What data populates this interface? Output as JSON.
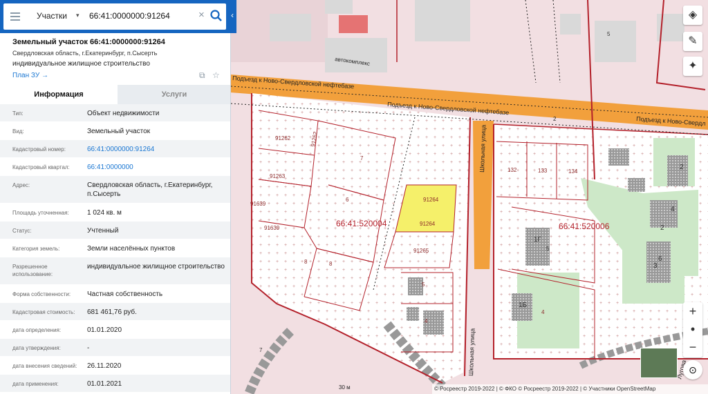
{
  "search": {
    "type_label": "Участки",
    "value": "66:41:0000000:91264"
  },
  "parcel": {
    "title": "Земельный участок 66:41:0000000:91264",
    "address": "Свердловская область, г.Екатеринбург, п.Сысерть",
    "use": "индивидуальное жилищное строительство",
    "plan_link": "План ЗУ →"
  },
  "tabs": [
    {
      "label": "Информация"
    },
    {
      "label": "Услуги"
    }
  ],
  "info_rows": [
    {
      "label": "Тип:",
      "value": "Объект недвижимости"
    },
    {
      "label": "Вид:",
      "value": "Земельный участок"
    },
    {
      "label": "Кадастровый номер:",
      "value": "66:41:0000000:91264"
    },
    {
      "label": "Кадастровый квартал:",
      "value": "66:41:0000000"
    },
    {
      "label": "Адрес:",
      "value": "Свердловская область, г.Екатеринбург, п.Сысерть"
    },
    {
      "label": "Площадь уточненная:",
      "value": "1 024 кв. м"
    },
    {
      "label": "Статус:",
      "value": "Учтенный"
    },
    {
      "label": "Категория земель:",
      "value": "Земли населённых пунктов"
    },
    {
      "label": "Разрешенное использование:",
      "value": "индивидуальное жилищное строительство"
    },
    {
      "label": "Форма собственности:",
      "value": "Частная собственность"
    },
    {
      "label": "Кадастровая стоимость:",
      "value": "681 461,76 руб."
    },
    {
      "label": "дата определения:",
      "value": "01.01.2020"
    },
    {
      "label": "дата утверждения:",
      "value": "-"
    },
    {
      "label": "дата внесения сведений:",
      "value": "26.11.2020"
    },
    {
      "label": "дата применения:",
      "value": "01.01.2021"
    }
  ],
  "map": {
    "road_label_1": "Подъезд к Ново-Свердловской нефтебазе",
    "road_label_2": "Подъезд к Ново-Свердл",
    "road_label_3": "Подъезд к Ново-Свердловской нефтебазе",
    "road_label_4": "автокомплекс",
    "road_number": "2",
    "street_1": "Школьная улица",
    "street_2": "Школьная улица",
    "street_3": "Лугова",
    "quarter_1": "66:41:520004",
    "quarter_2": "66:41:520006",
    "selected_parcel": "91264",
    "selected_parcel_2": "91264",
    "parcels": [
      "91262",
      "91263",
      "91639",
      "91639",
      "91265",
      "7",
      "6",
      "8",
      "8",
      "132",
      "133",
      "134",
      "1Г",
      "1Б",
      "4",
      "5",
      "4",
      "2",
      "4",
      "2",
      "3",
      "6",
      "5",
      "7",
      "5",
      "91262"
    ],
    "highlight_color": "#f5f06a",
    "attribution": "© Росреестр 2019-2022 | © ФКО © Росреестр 2019-2022 | © Участники OpenStreetMap",
    "scale_label": "30 м"
  }
}
